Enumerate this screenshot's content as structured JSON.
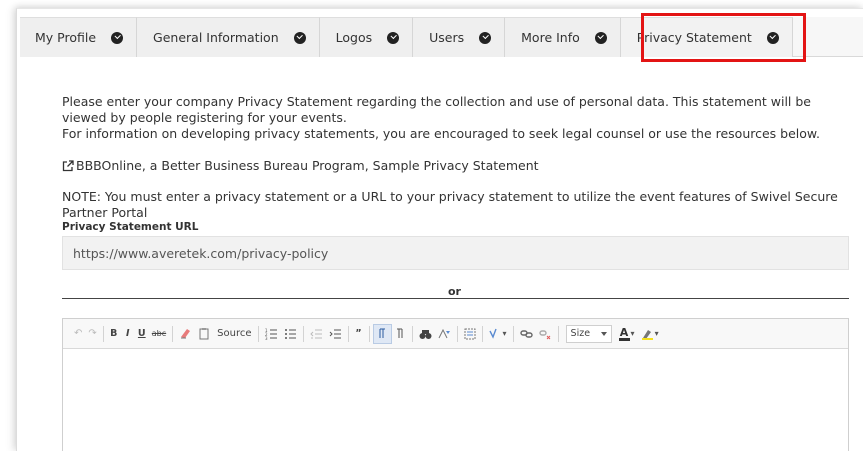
{
  "tabs": [
    {
      "label": "My Profile"
    },
    {
      "label": "General Information"
    },
    {
      "label": "Logos"
    },
    {
      "label": "Users"
    },
    {
      "label": "More Info"
    },
    {
      "label": "Privacy Statement"
    }
  ],
  "content": {
    "intro": "Please enter your company Privacy Statement regarding the collection and use of personal data. This statement will be viewed by people registering for your events.",
    "info": "For information on developing privacy statements, you are encouraged to seek legal counsel or use the resources below.",
    "bbb_link": "BBBOnline, a Better Business Bureau Program, Sample Privacy Statement",
    "note": "NOTE: You must enter a privacy statement or a URL to your privacy statement to utilize the event features of Swivel Secure Partner Portal",
    "url_label": "Privacy Statement URL",
    "url_value": "https://www.averetek.com/privacy-policy",
    "or_text": "or"
  },
  "editor": {
    "source_label": "Source",
    "size_label": "Size",
    "toolbar": [
      "undo",
      "redo",
      "bold",
      "italic",
      "underline",
      "strikethrough",
      "remove-format",
      "paste-special",
      "source",
      "numbered-list",
      "bulleted-list",
      "outdent",
      "indent",
      "blockquote",
      "align-left",
      "align-right",
      "find",
      "replace",
      "select-all",
      "spellcheck",
      "link",
      "unlink",
      "size",
      "text-color",
      "background-color"
    ],
    "b": "B",
    "i": "I",
    "u": "U",
    "abc": "abc",
    "a": "A"
  },
  "colors": {
    "highlight": "#e31414",
    "tab_bg": "#efefef",
    "check": "#222222"
  }
}
